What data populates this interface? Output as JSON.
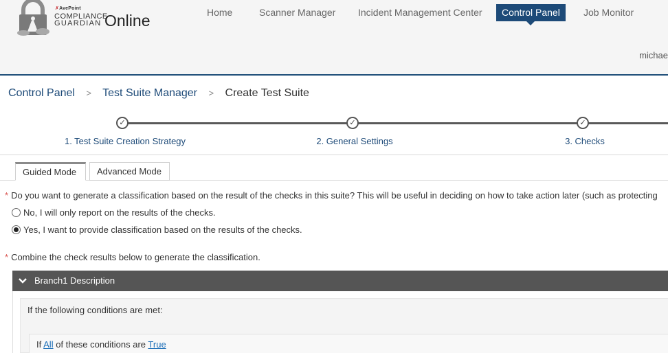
{
  "brand": {
    "vendor": "AvePoint",
    "line1": "COMPLIANCE",
    "line2": "GUARDIAN",
    "product": "Online"
  },
  "nav": {
    "items": [
      {
        "label": "Home"
      },
      {
        "label": "Scanner Manager"
      },
      {
        "label": "Incident Management Center"
      },
      {
        "label": "Control Panel",
        "active": true
      },
      {
        "label": "Job Monitor"
      }
    ]
  },
  "user": {
    "name": "michae"
  },
  "breadcrumb": {
    "items": [
      "Control Panel",
      "Test Suite Manager",
      "Create Test Suite"
    ],
    "separator": ">"
  },
  "stepper": {
    "steps": [
      {
        "label": "1. Test Suite Creation Strategy",
        "done": true
      },
      {
        "label": "2. General Settings",
        "done": true
      },
      {
        "label": "3. Checks",
        "done": true
      }
    ]
  },
  "tabs": {
    "items": [
      {
        "label": "Guided Mode",
        "active": true
      },
      {
        "label": "Advanced Mode",
        "active": false
      }
    ]
  },
  "form": {
    "required_marker": "*",
    "question1": "Do you want to generate a classification based on the result of the checks in this suite? This will be useful in deciding on how to take action later (such as protecting",
    "options": [
      {
        "label": "No, I will only report on the results of the checks.",
        "checked": false
      },
      {
        "label": "Yes, I want to provide classification based on the results of the checks.",
        "checked": true
      }
    ],
    "question2": "Combine the check results below to generate the classification."
  },
  "branch": {
    "title": "Branch1 Description",
    "conditions_heading": "If the following conditions are met:",
    "rule_prefix": "If",
    "rule_quantifier": "All",
    "rule_middle": "of these conditions are",
    "rule_value": "True"
  },
  "colors": {
    "brand_blue": "#1d4a78",
    "link_blue": "#1d6fb8",
    "required_red": "#d9534f",
    "branch_header": "#555555"
  }
}
